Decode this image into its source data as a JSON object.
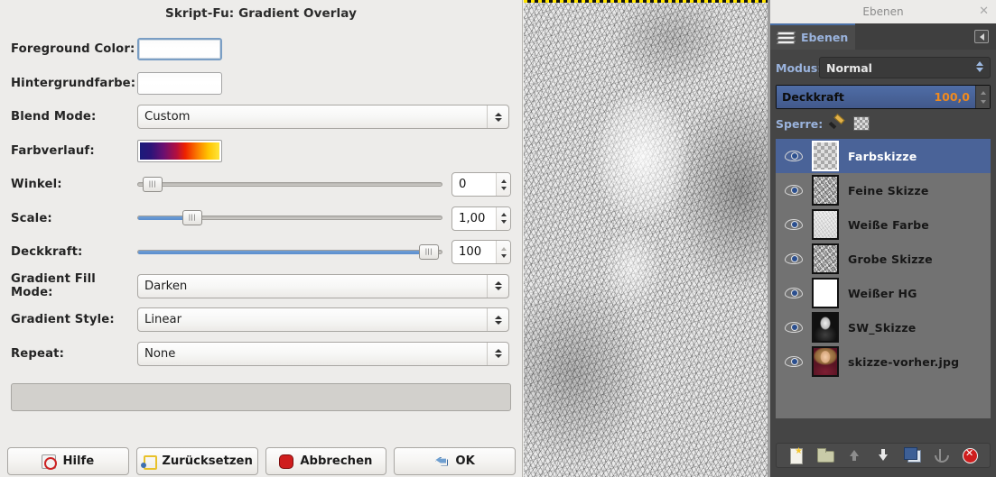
{
  "dialog": {
    "title": "Skript-Fu: Gradient Overlay",
    "fields": {
      "foreground_label": "Foreground Color:",
      "background_label": "Hintergrundfarbe:",
      "blend_mode_label": "Blend Mode:",
      "blend_mode_value": "Custom",
      "gradient_label": "Farbverlauf:",
      "angle_label": "Winkel:",
      "angle_value": "0",
      "scale_label": "Scale:",
      "scale_value": "1,00",
      "opacity_label": "Deckkraft:",
      "opacity_value": "100",
      "fill_mode_label": "Gradient Fill Mode:",
      "fill_mode_value": "Darken",
      "style_label": "Gradient Style:",
      "style_value": "Linear",
      "repeat_label": "Repeat:",
      "repeat_value": "None"
    },
    "buttons": [
      {
        "label": "Hilfe",
        "icon": "help-icon"
      },
      {
        "label": "Zurücksetzen",
        "icon": "reset-icon"
      },
      {
        "label": "Abbrechen",
        "icon": "cancel-icon"
      },
      {
        "label": "OK",
        "icon": "ok-icon"
      }
    ]
  },
  "layers_panel": {
    "window_title": "Ebenen",
    "tab_label": "Ebenen",
    "mode_label": "Modus:",
    "mode_value": "Normal",
    "opacity_label": "Deckkraft",
    "opacity_value": "100,0",
    "lock_label": "Sperre:",
    "layers": [
      {
        "name": "Farbskizze",
        "selected": true,
        "thumb": "transparent"
      },
      {
        "name": "Feine Skizze",
        "selected": false,
        "thumb": "sketchy"
      },
      {
        "name": "Weiße Farbe",
        "selected": false,
        "thumb": "light"
      },
      {
        "name": "Grobe Skizze",
        "selected": false,
        "thumb": "sketchy"
      },
      {
        "name": "Weißer HG",
        "selected": false,
        "thumb": "white"
      },
      {
        "name": "SW_Skizze",
        "selected": false,
        "thumb": "sw"
      },
      {
        "name": "skizze-vorher.jpg",
        "selected": false,
        "thumb": "photo"
      }
    ],
    "toolbar": [
      "new-layer-icon",
      "new-layer-group-icon",
      "raise-layer-icon",
      "lower-layer-icon",
      "duplicate-layer-icon",
      "anchor-layer-icon",
      "delete-layer-icon"
    ]
  },
  "colors": {
    "dialog_bg": "#edecea",
    "panel_bg": "#454545",
    "list_bg": "#727272",
    "selection_blue": "#4a6398",
    "accent_orange": "#f08a1e",
    "label_blue": "#9ab3dd",
    "slider_blue": "#5b8dcc"
  }
}
